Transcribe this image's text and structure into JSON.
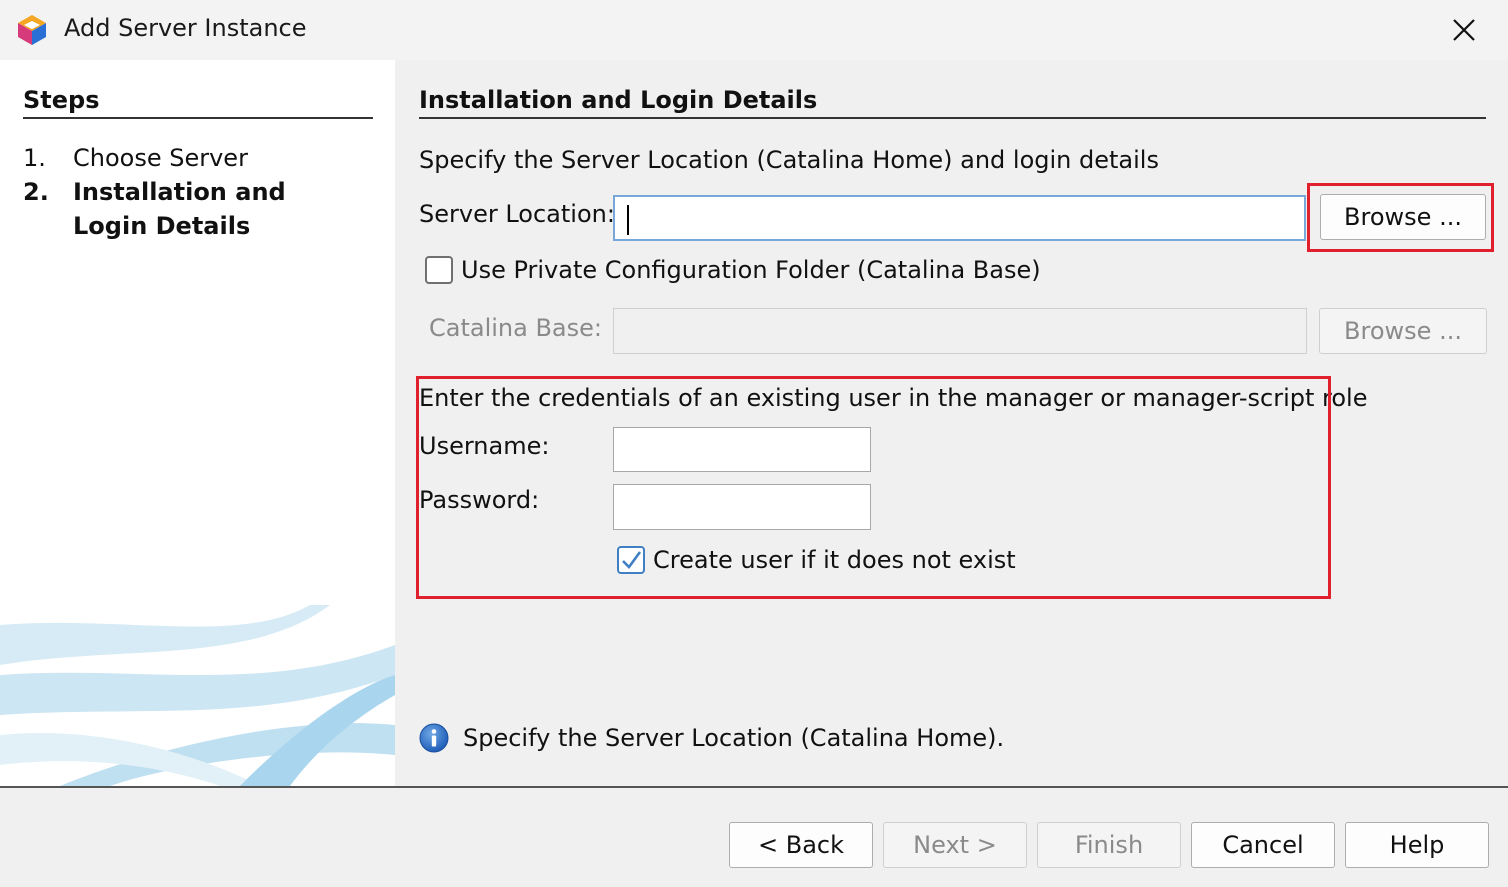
{
  "window": {
    "title": "Add Server Instance",
    "logo_icon": "netbeans-cube-icon",
    "close_icon": "close-icon"
  },
  "steps": {
    "title": "Steps",
    "items": [
      {
        "number": "1.",
        "label": "Choose Server",
        "active": false
      },
      {
        "number": "2.",
        "label": "Installation and Login Details",
        "active": true
      }
    ]
  },
  "main": {
    "section_title": "Installation and Login Details",
    "description": "Specify the Server Location (Catalina Home) and login details",
    "server_location": {
      "label": "Server Location:",
      "value": "",
      "browse_label": "Browse ..."
    },
    "private_config": {
      "label": "Use Private Configuration Folder (Catalina Base)",
      "checked": false
    },
    "catalina_base": {
      "label": "Catalina Base:",
      "value": "",
      "browse_label": "Browse ...",
      "enabled": false
    },
    "credentials": {
      "intro": "Enter the credentials of an existing user in the manager or manager-script role",
      "username_label": "Username:",
      "username_value": "",
      "password_label": "Password:",
      "password_value": "",
      "create_user_label": "Create user if it does not exist",
      "create_user_checked": true
    },
    "info_message": "Specify the Server Location (Catalina Home).",
    "info_icon": "info-icon"
  },
  "buttons": {
    "back": "< Back",
    "next": "Next >",
    "finish": "Finish",
    "cancel": "Cancel",
    "help": "Help"
  },
  "colors": {
    "highlight": "#e0202c",
    "focus": "#7aa7d9",
    "check": "#3f7fc4"
  }
}
